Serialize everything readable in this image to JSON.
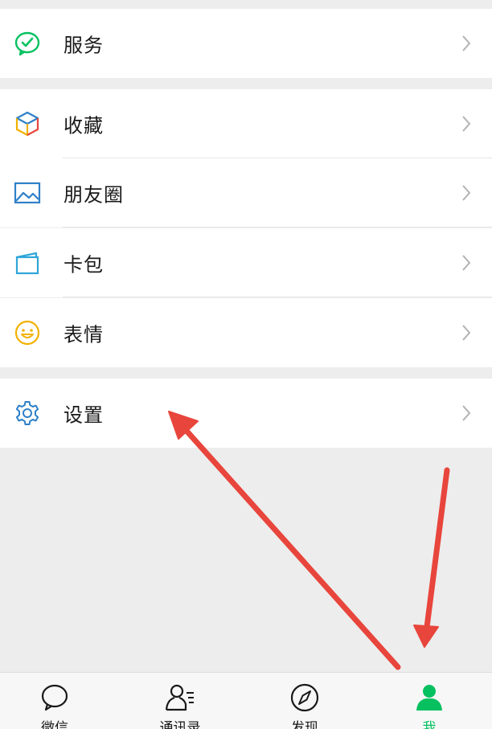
{
  "menu": {
    "services": {
      "label": "服务",
      "icon": "services-check-icon"
    },
    "favorites": {
      "label": "收藏",
      "icon": "favorites-cube-icon"
    },
    "moments": {
      "label": "朋友圈",
      "icon": "moments-image-icon"
    },
    "cards": {
      "label": "卡包",
      "icon": "card-wallet-icon"
    },
    "stickers": {
      "label": "表情",
      "icon": "smiley-icon"
    },
    "settings": {
      "label": "设置",
      "icon": "gear-icon"
    }
  },
  "tabbar": {
    "tabs": [
      {
        "label": "微信",
        "icon": "chat-bubble-icon",
        "active": false
      },
      {
        "label": "通讯录",
        "icon": "contacts-icon",
        "active": false
      },
      {
        "label": "发现",
        "icon": "compass-icon",
        "active": false
      },
      {
        "label": "我",
        "icon": "person-icon",
        "active": true
      }
    ]
  },
  "colors": {
    "accent_green": "#07c160",
    "annotation_red": "#e8453c",
    "icon_blue": "#2f80c8",
    "background": "#ededed"
  }
}
